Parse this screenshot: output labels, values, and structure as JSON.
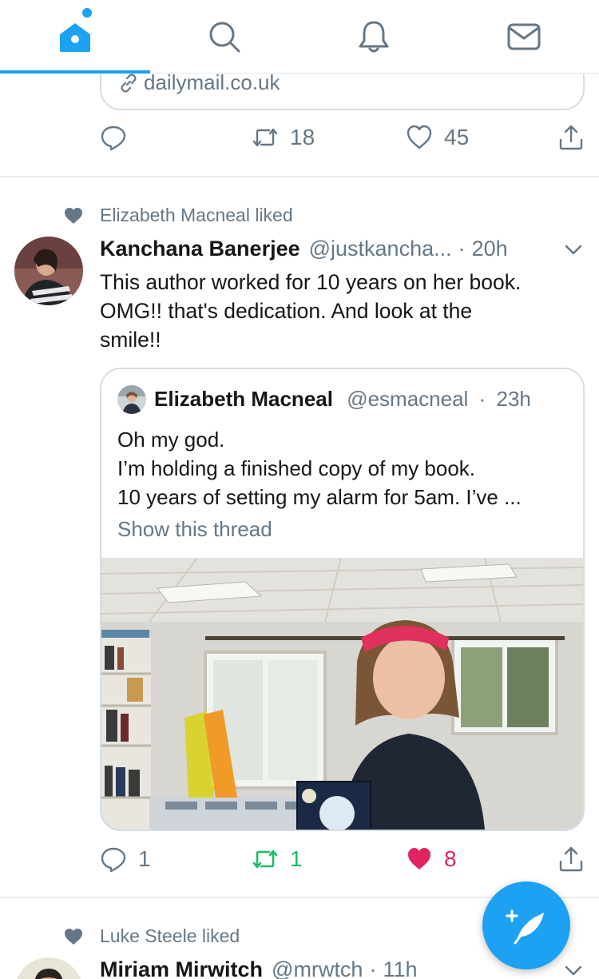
{
  "nav": {
    "tabs": [
      {
        "name": "home",
        "icon": "home-icon",
        "active": true
      },
      {
        "name": "search",
        "icon": "search-icon"
      },
      {
        "name": "notifications",
        "icon": "bell-icon"
      },
      {
        "name": "messages",
        "icon": "mail-icon"
      }
    ],
    "accent": "#1da1f2"
  },
  "prev_tweet": {
    "link_domain": "dailymail.co.uk",
    "reply_count": "",
    "retweet_count": "18",
    "like_count": "45"
  },
  "tweets": [
    {
      "social_context": "Elizabeth Macneal liked",
      "name": "Kanchana Banerjee",
      "handle": "@justkancha...",
      "separator": "·",
      "time": "20h",
      "text_lines": [
        "This author worked for 10 years on her book.",
        "OMG!! that's dedication. And look at the",
        "smile!!"
      ],
      "quote": {
        "name": "Elizabeth Macneal",
        "handle": "@esmacneal",
        "separator": "·",
        "time": "23h",
        "text_lines": [
          "Oh my god.",
          "I’m holding a finished copy of my book.",
          "10 years of setting my alarm for 5am. I’ve ..."
        ],
        "thread_link": "Show this thread"
      },
      "reply_count": "1",
      "retweet_count": "1",
      "like_count": "8",
      "liked": true,
      "retweeted": true
    },
    {
      "social_context": "Luke Steele liked",
      "name": "Miriam Mirwitch",
      "handle": "@mrwtch",
      "separator": "·",
      "time": "11h"
    }
  ],
  "colors": {
    "like_active": "#e0245e",
    "retweet_active": "#17bf63",
    "secondary_text": "#657786"
  }
}
